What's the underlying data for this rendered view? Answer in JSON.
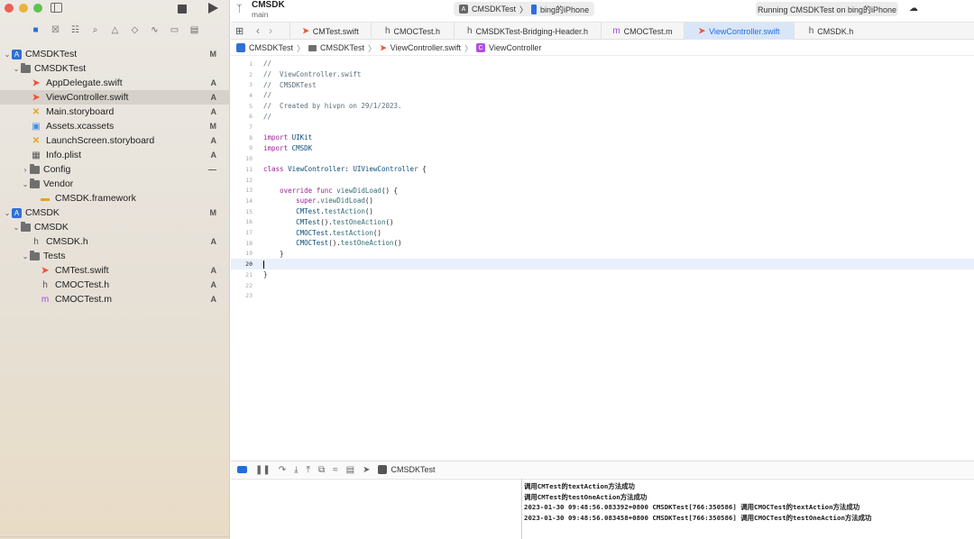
{
  "toolbar": {
    "project_name": "CMSDK",
    "branch": "main",
    "scheme_name": "CMSDKTest",
    "device_name": "bing的iPhone",
    "status_text": "Running CMSDKTest on bing的iPhone"
  },
  "tree": [
    {
      "label": "CMSDKTest",
      "status": "M",
      "depth": 0,
      "chevron": "open",
      "icon": "project-icon"
    },
    {
      "label": "CMSDKTest",
      "status": "",
      "depth": 1,
      "chevron": "open",
      "icon": "folder-icon"
    },
    {
      "label": "AppDelegate.swift",
      "status": "A",
      "depth": 2,
      "chevron": "",
      "icon": "swift-file-icon"
    },
    {
      "label": "ViewController.swift",
      "status": "A",
      "depth": 2,
      "chevron": "",
      "icon": "swift-file-icon",
      "selected": true
    },
    {
      "label": "Main.storyboard",
      "status": "A",
      "depth": 2,
      "chevron": "",
      "icon": "storyboard-icon"
    },
    {
      "label": "Assets.xcassets",
      "status": "M",
      "depth": 2,
      "chevron": "",
      "icon": "assets-icon"
    },
    {
      "label": "LaunchScreen.storyboard",
      "status": "A",
      "depth": 2,
      "chevron": "",
      "icon": "storyboard-icon"
    },
    {
      "label": "Info.plist",
      "status": "A",
      "depth": 2,
      "chevron": "",
      "icon": "plist-icon"
    },
    {
      "label": "Config",
      "status": "—",
      "depth": 2,
      "chevron": "closed",
      "icon": "folder-icon"
    },
    {
      "label": "Vendor",
      "status": "",
      "depth": 2,
      "chevron": "open",
      "icon": "folder-icon"
    },
    {
      "label": "CMSDK.framework",
      "status": "",
      "depth": 3,
      "chevron": "",
      "icon": "framework-icon"
    },
    {
      "label": "CMSDK",
      "status": "M",
      "depth": 0,
      "chevron": "open",
      "icon": "project-icon"
    },
    {
      "label": "CMSDK",
      "status": "",
      "depth": 1,
      "chevron": "open",
      "icon": "folder-icon"
    },
    {
      "label": "CMSDK.h",
      "status": "A",
      "depth": 2,
      "chevron": "",
      "icon": "header-file-icon"
    },
    {
      "label": "Tests",
      "status": "",
      "depth": 2,
      "chevron": "open",
      "icon": "folder-icon"
    },
    {
      "label": "CMTest.swift",
      "status": "A",
      "depth": 3,
      "chevron": "",
      "icon": "swift-file-icon"
    },
    {
      "label": "CMOCTest.h",
      "status": "A",
      "depth": 3,
      "chevron": "",
      "icon": "header-file-icon"
    },
    {
      "label": "CMOCTest.m",
      "status": "A",
      "depth": 3,
      "chevron": "",
      "icon": "objc-file-icon"
    }
  ],
  "tabs": [
    {
      "label": "CMTest.swift",
      "icon": "swift"
    },
    {
      "label": "CMOCTest.h",
      "icon": "h"
    },
    {
      "label": "CMSDKTest-Bridging-Header.h",
      "icon": "h"
    },
    {
      "label": "CMOCTest.m",
      "icon": "m"
    },
    {
      "label": "ViewController.swift",
      "icon": "swift",
      "active": true
    },
    {
      "label": "CMSDK.h",
      "icon": "h"
    }
  ],
  "breadcrumb": {
    "project": "CMSDKTest",
    "folder": "CMSDKTest",
    "file": "ViewController.swift",
    "symbol": "ViewController",
    "symbol_badge": "C"
  },
  "code": {
    "current_line": 20,
    "lines": [
      "//",
      "//  ViewController.swift",
      "//  CMSDKTest",
      "//",
      "//  Created by hivpn on 29/1/2023.",
      "//",
      "",
      "import UIKit",
      "import CMSDK",
      "",
      "class ViewController: UIViewController {",
      "",
      "    override func viewDidLoad() {",
      "        super.viewDidLoad()",
      "        CMTest.testAction()",
      "        CMTest().testOneAction()",
      "        CMOCTest.testAction()",
      "        CMOCTest().testOneAction()",
      "    }",
      "",
      "}",
      "",
      ""
    ]
  },
  "debugbar": {
    "target": "CMSDKTest"
  },
  "console": [
    "调用CMTest的textAction方法成功",
    "调用CMTest的testOneAction方法成功",
    "2023-01-30 09:48:56.083392+0800 CMSDKTest[766:350586] 调用CMOCTest的textAction方法成功",
    "2023-01-30 09:48:56.083458+0800 CMSDKTest[766:350586] 调用CMOCTest的testOneAction方法成功"
  ]
}
